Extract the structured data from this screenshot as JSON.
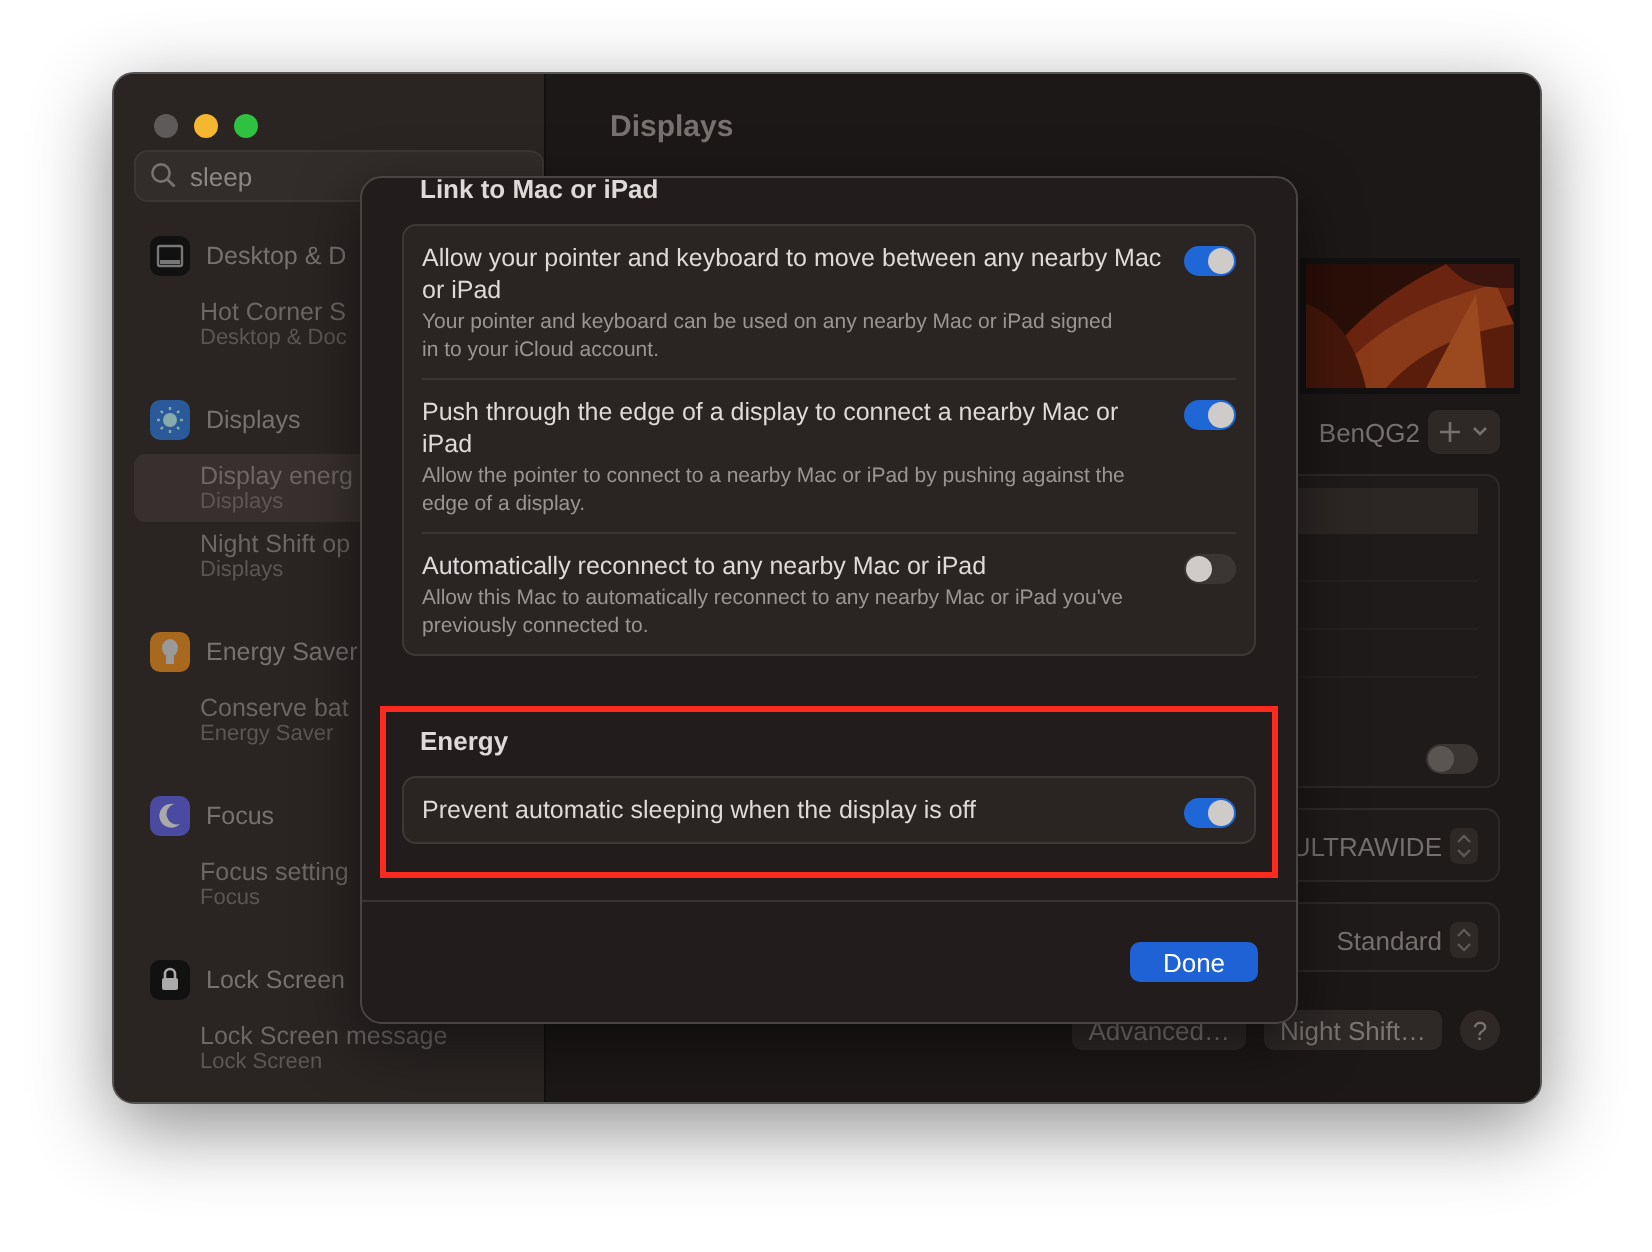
{
  "window": {
    "title": "Displays"
  },
  "search": {
    "value": "sleep"
  },
  "sidebar": {
    "groups": [
      {
        "kind": "dock",
        "title": "Desktop & D",
        "results": [
          {
            "title": "Hot Corner S",
            "subtitle": "Desktop & Doc",
            "selected": false
          }
        ]
      },
      {
        "kind": "displays",
        "title": "Displays",
        "results": [
          {
            "title": "Display energ",
            "subtitle": "Displays",
            "selected": true
          },
          {
            "title": "Night Shift op",
            "subtitle": "Displays",
            "selected": false
          }
        ]
      },
      {
        "kind": "energy",
        "title": "Energy Saver",
        "results": [
          {
            "title": "Conserve bat",
            "subtitle": "Energy Saver",
            "selected": false
          }
        ]
      },
      {
        "kind": "focus",
        "title": "Focus",
        "results": [
          {
            "title": "Focus setting",
            "subtitle": "Focus",
            "selected": false
          }
        ]
      },
      {
        "kind": "lock",
        "title": "Lock Screen",
        "results": [
          {
            "title": "Lock Screen message",
            "subtitle": "Lock Screen",
            "selected": false
          }
        ]
      }
    ]
  },
  "display": {
    "name": "BenQG2",
    "setting_on": false,
    "resolution": "ULTRAWIDE",
    "mode": "Standard",
    "buttons": [
      "Advanced…",
      "Night Shift…",
      "?"
    ]
  },
  "sheet": {
    "sections": [
      {
        "title": "Link to Mac or iPad",
        "highlighted": false,
        "settings": [
          {
            "title": "Allow your pointer and keyboard to move between any nearby Mac or iPad",
            "description": "Your pointer and keyboard can be used on any nearby Mac or iPad signed in to your iCloud account.",
            "on": true
          },
          {
            "title": "Push through the edge of a display to connect a nearby Mac or iPad",
            "description": "Allow the pointer to connect to a nearby Mac or iPad by pushing against the edge of a display.",
            "on": true
          },
          {
            "title": "Automatically reconnect to any nearby Mac or iPad",
            "description": "Allow this Mac to automatically reconnect to any nearby Mac or iPad you've previously connected to.",
            "on": false
          }
        ]
      },
      {
        "title": "Energy",
        "highlighted": true,
        "settings": [
          {
            "title": "Prevent automatic sleeping when the display is off",
            "on": true
          }
        ]
      }
    ],
    "done_button": "Done"
  }
}
